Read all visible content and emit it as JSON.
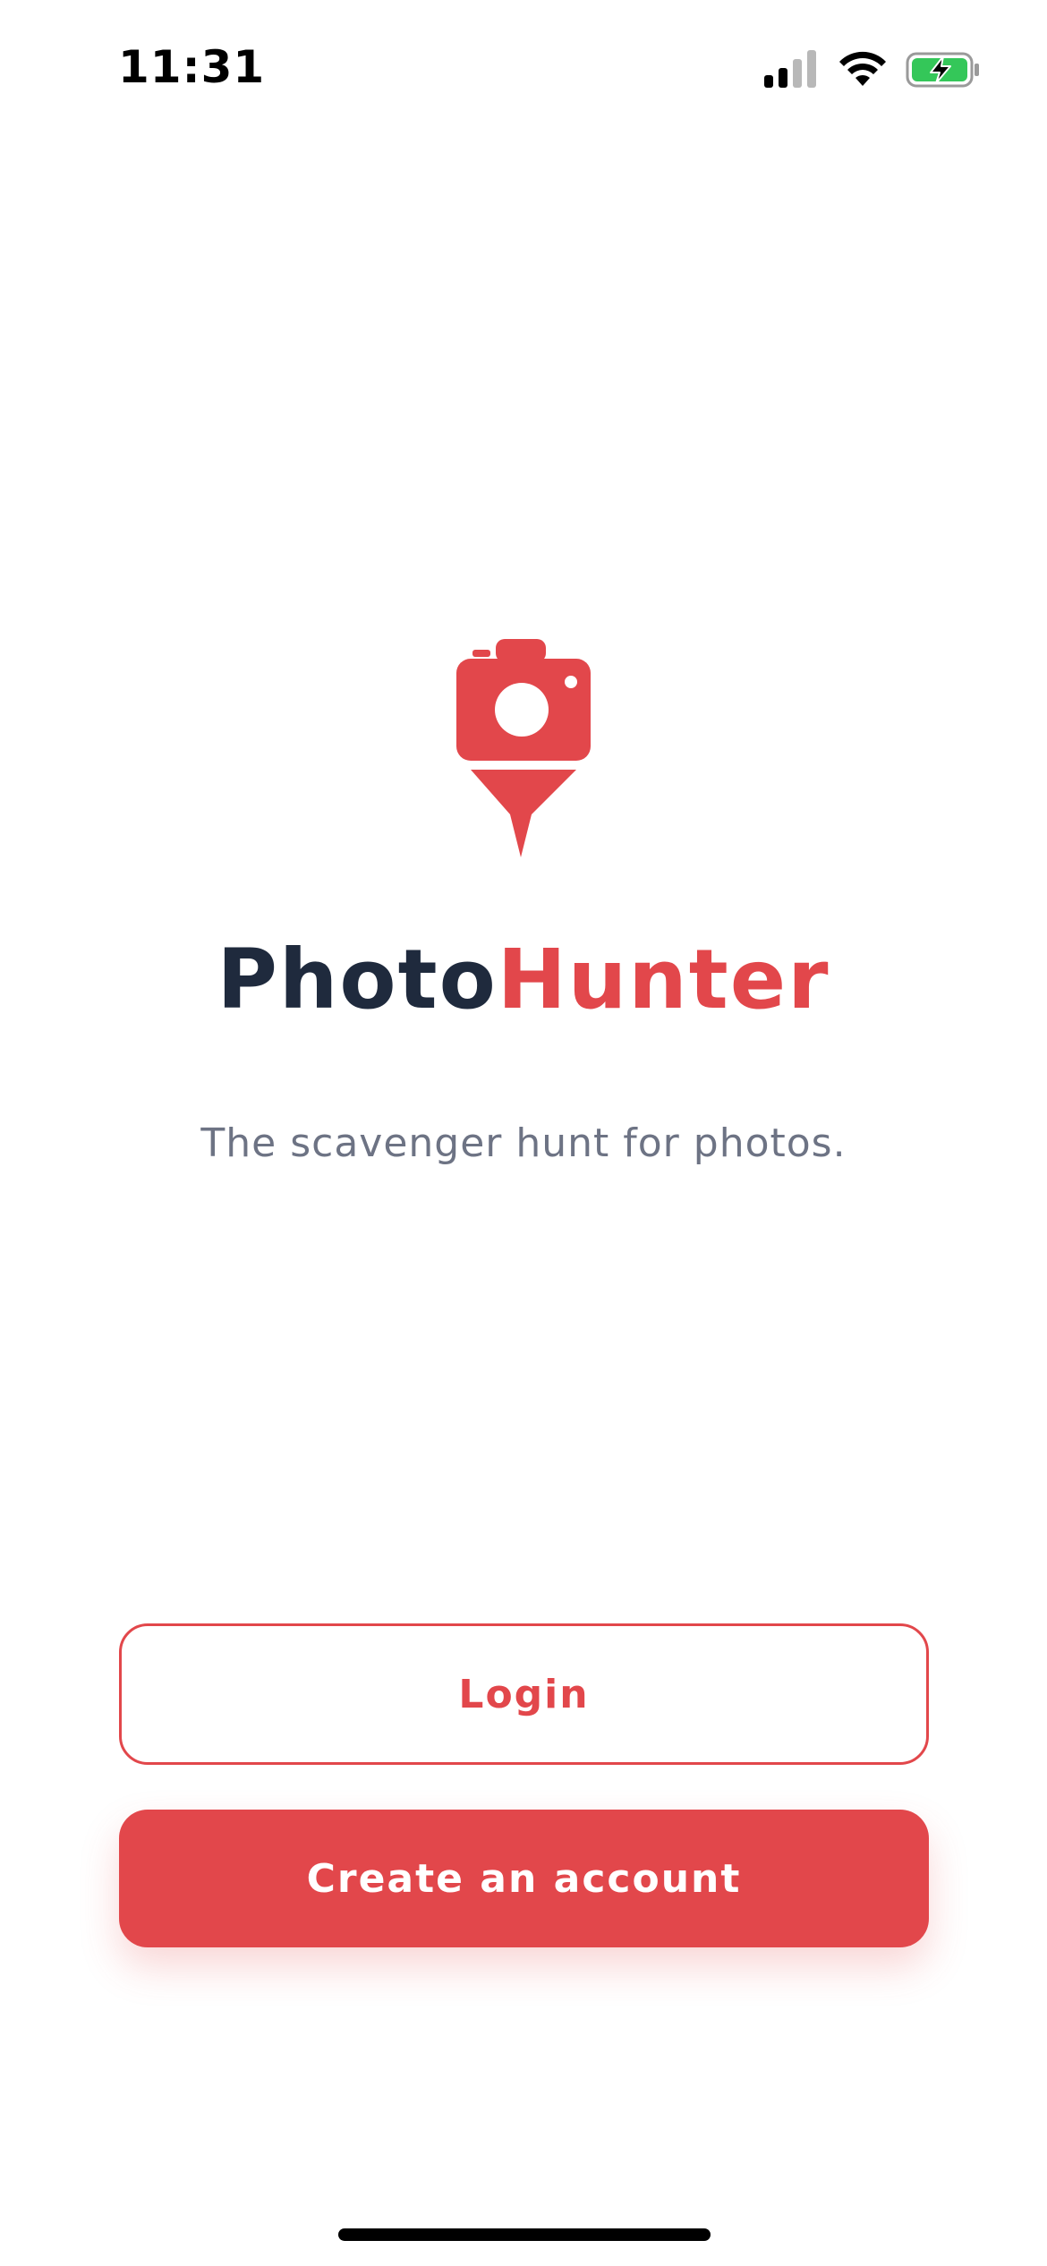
{
  "status_bar": {
    "time": "11:31",
    "icons": [
      "cellular-signal-icon",
      "wifi-icon",
      "battery-charging-icon"
    ],
    "battery_color": "#34c759"
  },
  "app": {
    "title_part_a": "Photo",
    "title_part_b": "Hunter",
    "tagline": "The scavenger hunt for photos.",
    "logo_icon": "camera-pin-icon"
  },
  "actions": {
    "login_label": "Login",
    "create_account_label": "Create an account"
  },
  "colors": {
    "brand_red": "#e2474b",
    "title_dark": "#1f2a3d",
    "tagline_gray": "#6d7384"
  }
}
